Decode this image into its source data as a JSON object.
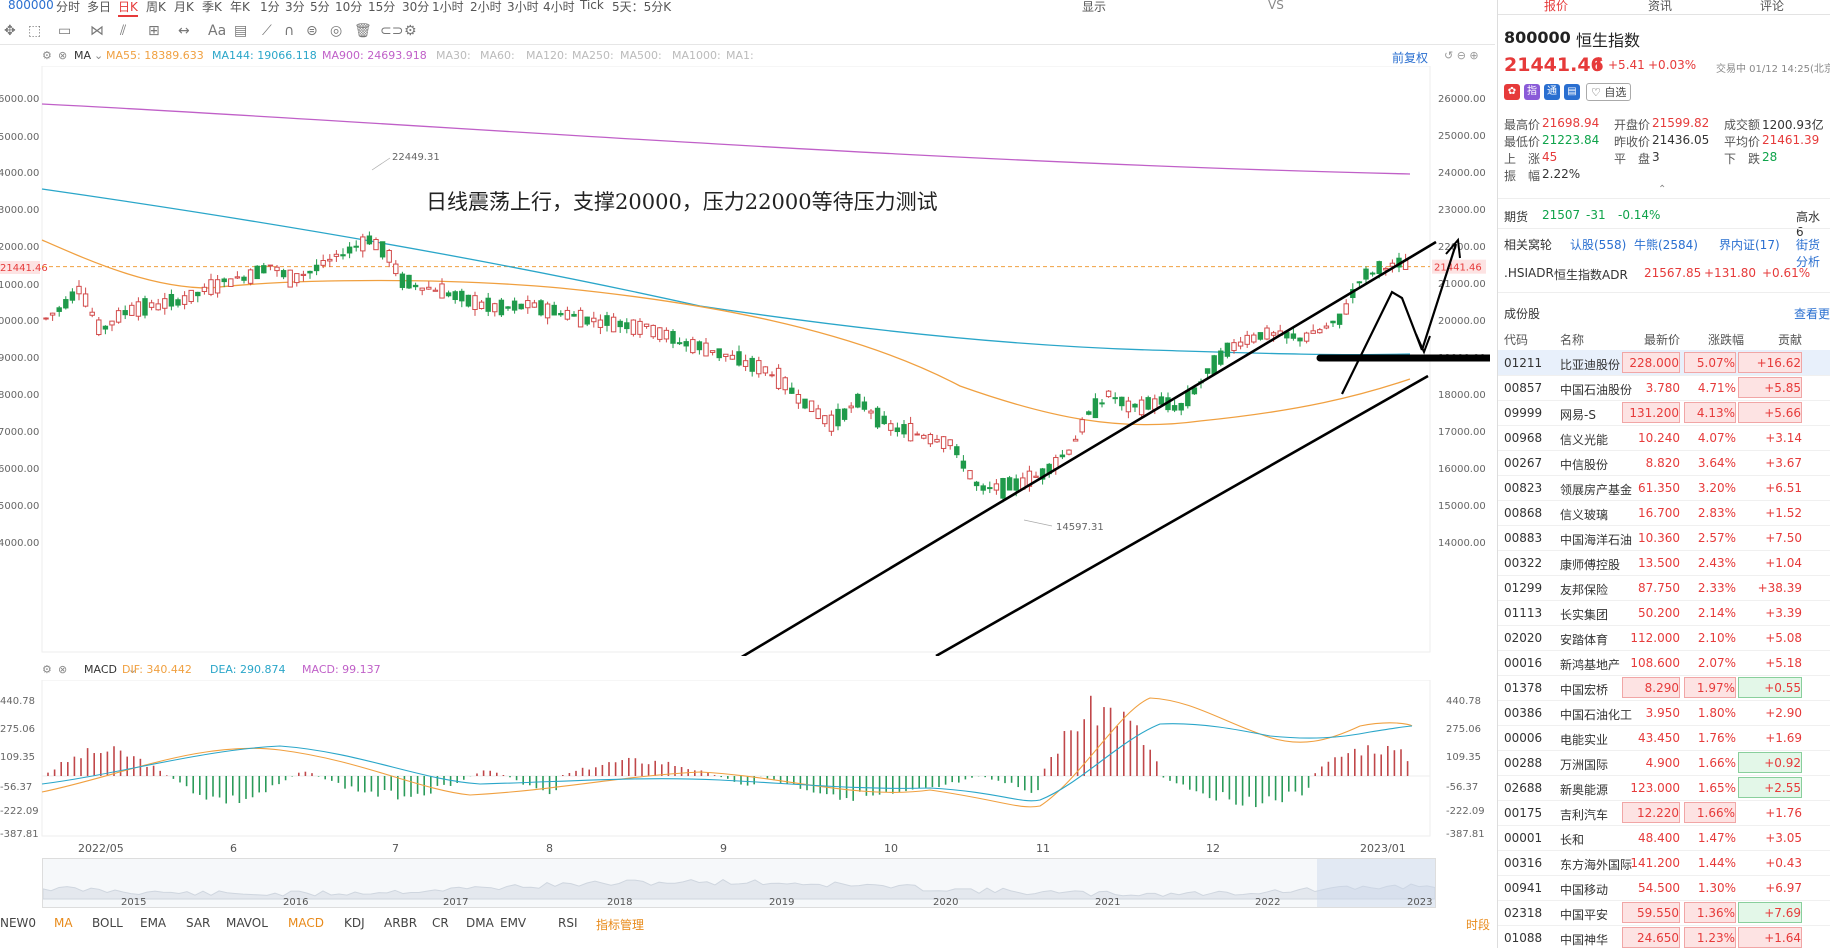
{
  "topbar": {
    "symbol": "800000",
    "timeframes": [
      "分时",
      "多日",
      "日K",
      "周K",
      "月K",
      "季K",
      "年K",
      "1分",
      "3分",
      "5分",
      "10分",
      "15分",
      "30分",
      "1小时",
      "2小时",
      "3小时",
      "4小时",
      "Tick",
      "5天：5分K"
    ],
    "active_timeframe": "日K",
    "display_label": "显示",
    "vs_label": "VS"
  },
  "ma_legend": {
    "title": "MA",
    "items": [
      {
        "label": "MA55: 18389.633",
        "color": "#f0a040"
      },
      {
        "label": "MA144: 19066.118",
        "color": "#2aa6c9"
      },
      {
        "label": "MA900: 24693.918",
        "color": "#c060c8"
      },
      {
        "label": "MA30:",
        "color": "#bbbbbb"
      },
      {
        "label": "MA60:",
        "color": "#bbbbbb"
      },
      {
        "label": "MA120:",
        "color": "#bbbbbb"
      },
      {
        "label": "MA250:",
        "color": "#bbbbbb"
      },
      {
        "label": "MA500:",
        "color": "#bbbbbb"
      },
      {
        "label": "MA1000:",
        "color": "#bbbbbb"
      },
      {
        "label": "MA1:",
        "color": "#bbbbbb"
      }
    ],
    "fq_label": "前复权"
  },
  "chart_data": {
    "type": "candlestick",
    "annotation": "日线震荡上行，支撑20000，压力22000等待压力测试",
    "y_ticks": [
      26000,
      25000,
      24000,
      23000,
      22000,
      21000,
      20000,
      19000,
      18000,
      17000,
      16000,
      15000,
      14000
    ],
    "y_tick_labels": [
      "26000.00",
      "25000.00",
      "24000.00",
      "23000.00",
      "22000.00",
      "21000.00",
      "20000.00",
      "19000.00",
      "18000.00",
      "17000.00",
      "16000.00",
      "15000.00",
      "14000.00"
    ],
    "left_tick_labels": [
      "6000.00",
      "5000.00",
      "4000.00",
      "3000.00",
      "2000.00",
      "21441.46",
      "1000.00",
      "0000.00",
      "9000.00",
      "8000.00",
      "7000.00",
      "6000.00",
      "5000.00",
      "4000.00"
    ],
    "current_price_label": "21441.46",
    "high_label": "22449.31",
    "low_label": "14597.31",
    "x_labels": [
      "2022/05",
      "6",
      "7",
      "8",
      "9",
      "10",
      "11",
      "12",
      "2023/01"
    ]
  },
  "macd_legend": {
    "title": "MACD",
    "items": [
      {
        "label": "DIF: 340.442",
        "color": "#f0a040"
      },
      {
        "label": "DEA: 290.874",
        "color": "#2aa6c9"
      },
      {
        "label": "MACD: 99.137",
        "color": "#c060c8"
      }
    ],
    "y_labels": [
      "440.78",
      "275.06",
      "109.35",
      "-56.37",
      "-222.09",
      "-387.81"
    ]
  },
  "overview": {
    "years": [
      "2015",
      "2016",
      "2017",
      "2018",
      "2019",
      "2020",
      "2021",
      "2022",
      "2023"
    ]
  },
  "indicators": {
    "items": [
      "NEW0",
      "MA",
      "BOLL",
      "EMA",
      "SAR",
      "MAVOL",
      "MACD",
      "KDJ",
      "ARBR",
      "CR",
      "DMA",
      "EMV",
      "RSI",
      "指标管理"
    ],
    "right_label": "时段"
  },
  "right_panel": {
    "tabs": [
      "报价",
      "资讯",
      "评论"
    ],
    "code": "800000",
    "name": "恒生指数",
    "price": "21441.46",
    "change": "+5.41",
    "change_pct": "+0.03%",
    "trade_status": "交易中 01/12 14:25(北京",
    "watch_label": "自选",
    "stats": [
      [
        {
          "k": "最高价",
          "v": "21698.94",
          "c": "red"
        },
        {
          "k": "开盘价",
          "v": "21599.82",
          "c": "red"
        },
        {
          "k": "成交额",
          "v": "1200.93亿",
          "c": ""
        }
      ],
      [
        {
          "k": "最低价",
          "v": "21223.84",
          "c": "green"
        },
        {
          "k": "昨收价",
          "v": "21436.05",
          "c": ""
        },
        {
          "k": "平均价",
          "v": "21461.39",
          "c": "red"
        }
      ],
      [
        {
          "k": "上　涨",
          "v": "45",
          "c": "red"
        },
        {
          "k": "平　盘",
          "v": "3",
          "c": ""
        },
        {
          "k": "下　跌",
          "v": "28",
          "c": "green"
        }
      ],
      [
        {
          "k": "振　幅",
          "v": "2.22%",
          "c": ""
        }
      ]
    ],
    "futures": {
      "label": "期货",
      "price": "21507",
      "change": "-31",
      "pct": "-0.14%",
      "right": "高水 6"
    },
    "related": {
      "label": "相关窝轮",
      "items": [
        "认股(558)",
        "牛熊(2584)",
        "界内证(17)",
        "街货分析"
      ]
    },
    "adr": {
      "code": ".HSIADR",
      "name": "恒生指数ADR",
      "price": "21567.85",
      "change": "+131.80",
      "pct": "+0.61%"
    },
    "constituents_title": "成份股",
    "view_more": "查看更",
    "table_headers": [
      "代码",
      "名称",
      "最新价",
      "涨跌幅",
      "贡献"
    ],
    "rows": [
      {
        "code": "01211",
        "name": "比亚迪股份",
        "price": "228.000",
        "pct": "5.07%",
        "contrib": "+16.62",
        "hp": true,
        "hc": "r"
      },
      {
        "code": "00857",
        "name": "中国石油股份",
        "price": "3.780",
        "pct": "4.71%",
        "contrib": "+5.85",
        "hp": false,
        "hc": "r"
      },
      {
        "code": "09999",
        "name": "网易-S",
        "price": "131.200",
        "pct": "4.13%",
        "contrib": "+5.66",
        "hp": true,
        "hc": "r"
      },
      {
        "code": "00968",
        "name": "信义光能",
        "price": "10.240",
        "pct": "4.07%",
        "contrib": "+3.14",
        "hp": false,
        "hc": ""
      },
      {
        "code": "00267",
        "name": "中信股份",
        "price": "8.820",
        "pct": "3.64%",
        "contrib": "+3.67",
        "hp": false,
        "hc": ""
      },
      {
        "code": "00823",
        "name": "领展房产基金",
        "price": "61.350",
        "pct": "3.20%",
        "contrib": "+6.51",
        "hp": false,
        "hc": ""
      },
      {
        "code": "00868",
        "name": "信义玻璃",
        "price": "16.700",
        "pct": "2.83%",
        "contrib": "+1.52",
        "hp": false,
        "hc": ""
      },
      {
        "code": "00883",
        "name": "中国海洋石油",
        "price": "10.360",
        "pct": "2.57%",
        "contrib": "+7.50",
        "hp": false,
        "hc": ""
      },
      {
        "code": "00322",
        "name": "康师傅控股",
        "price": "13.500",
        "pct": "2.43%",
        "contrib": "+1.04",
        "hp": false,
        "hc": ""
      },
      {
        "code": "01299",
        "name": "友邦保险",
        "price": "87.750",
        "pct": "2.33%",
        "contrib": "+38.39",
        "hp": false,
        "hc": ""
      },
      {
        "code": "01113",
        "name": "长实集团",
        "price": "50.200",
        "pct": "2.14%",
        "contrib": "+3.39",
        "hp": false,
        "hc": ""
      },
      {
        "code": "02020",
        "name": "安踏体育",
        "price": "112.000",
        "pct": "2.10%",
        "contrib": "+5.08",
        "hp": false,
        "hc": ""
      },
      {
        "code": "00016",
        "name": "新鸿基地产",
        "price": "108.600",
        "pct": "2.07%",
        "contrib": "+5.18",
        "hp": false,
        "hc": ""
      },
      {
        "code": "01378",
        "name": "中国宏桥",
        "price": "8.290",
        "pct": "1.97%",
        "contrib": "+0.55",
        "hp": true,
        "hc": "g"
      },
      {
        "code": "00386",
        "name": "中国石油化工",
        "price": "3.950",
        "pct": "1.80%",
        "contrib": "+2.90",
        "hp": false,
        "hc": ""
      },
      {
        "code": "00006",
        "name": "电能实业",
        "price": "43.450",
        "pct": "1.76%",
        "contrib": "+1.69",
        "hp": false,
        "hc": ""
      },
      {
        "code": "00288",
        "name": "万洲国际",
        "price": "4.900",
        "pct": "1.66%",
        "contrib": "+0.92",
        "hp": false,
        "hc": "g"
      },
      {
        "code": "02688",
        "name": "新奥能源",
        "price": "123.000",
        "pct": "1.65%",
        "contrib": "+2.55",
        "hp": false,
        "hc": "g"
      },
      {
        "code": "00175",
        "name": "吉利汽车",
        "price": "12.220",
        "pct": "1.66%",
        "contrib": "+1.76",
        "hp": true,
        "hc": ""
      },
      {
        "code": "00001",
        "name": "长和",
        "price": "48.400",
        "pct": "1.47%",
        "contrib": "+3.05",
        "hp": false,
        "hc": ""
      },
      {
        "code": "00316",
        "name": "东方海外国际",
        "price": "141.200",
        "pct": "1.44%",
        "contrib": "+0.43",
        "hp": false,
        "hc": ""
      },
      {
        "code": "00941",
        "name": "中国移动",
        "price": "54.500",
        "pct": "1.30%",
        "contrib": "+6.97",
        "hp": false,
        "hc": ""
      },
      {
        "code": "02318",
        "name": "中国平安",
        "price": "59.550",
        "pct": "1.36%",
        "contrib": "+7.69",
        "hp": true,
        "hc": "g"
      },
      {
        "code": "01088",
        "name": "中国神华",
        "price": "24.650",
        "pct": "1.23%",
        "contrib": "+1.64",
        "hp": true,
        "hc": "r"
      }
    ]
  }
}
